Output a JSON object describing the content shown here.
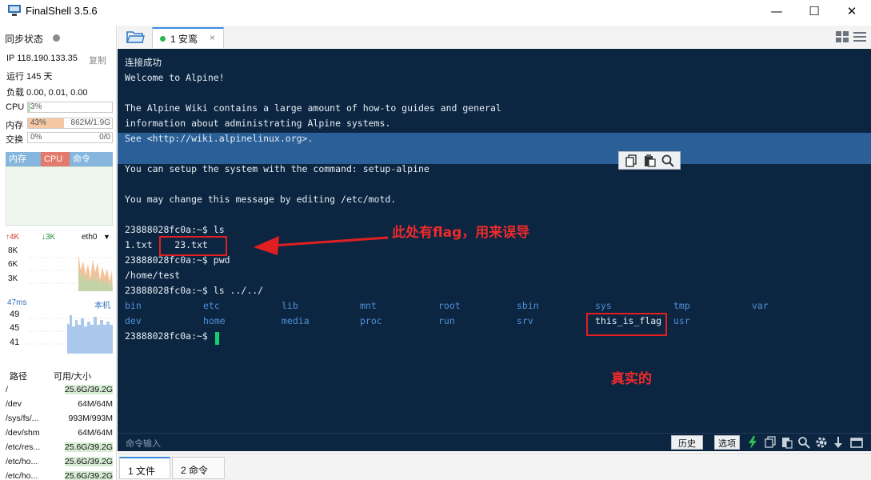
{
  "window": {
    "title": "FinalShell 3.5.6",
    "minimize": "—",
    "maximize": "☐",
    "close": "✕"
  },
  "sidebar": {
    "sync_label": "同步状态",
    "ip_label": "IP 118.190.133.35",
    "copy_label": "复制",
    "uptime": "运行 145 天",
    "load": "负载 0.00, 0.01, 0.00",
    "cpu": {
      "label": "CPU",
      "percent": "3%",
      "fraction": 0.03
    },
    "mem": {
      "label": "内存",
      "percent": "43%",
      "value": "862M/1.9G",
      "fraction": 0.43
    },
    "swap": {
      "label": "交换",
      "percent": "0%",
      "value": "0/0",
      "fraction": 0.0
    },
    "proc_tabs": [
      "内存",
      "CPU",
      "命令"
    ],
    "net": {
      "up": "↑4K",
      "down": "↓3K",
      "iface": "eth0",
      "axis": [
        "8K",
        "6K",
        "3K"
      ]
    },
    "ping": {
      "label": "47ms",
      "host": "本机",
      "axis": [
        "49",
        "45",
        "41"
      ]
    },
    "disk": {
      "headers": [
        "路径",
        "可用/大小"
      ],
      "rows": [
        {
          "path": "/",
          "size": "25.6G/39.2G"
        },
        {
          "path": "/dev",
          "size": "64M/64M"
        },
        {
          "path": "/sys/fs/...",
          "size": "993M/993M"
        },
        {
          "path": "/dev/shm",
          "size": "64M/64M"
        },
        {
          "path": "/etc/res...",
          "size": "25.6G/39.2G"
        },
        {
          "path": "/etc/ho...",
          "size": "25.6G/39.2G"
        },
        {
          "path": "/etc/ho...",
          "size": "25.6G/39.2G"
        }
      ]
    }
  },
  "tabs": {
    "session": {
      "label": "1 安鸾",
      "close": "×"
    }
  },
  "terminal": {
    "lines": [
      "连接成功",
      "Welcome to Alpine!",
      "",
      "The Alpine Wiki contains a large amount of how-to guides and general",
      "information about administrating Alpine systems.",
      "See <http://wiki.alpinelinux.org>.",
      "",
      "You can setup the system with the command: setup-alpine",
      "",
      "You may change this message by editing /etc/motd.",
      "",
      "23888028fc0a:~$ ls",
      "1.txt    23.txt",
      "23888028fc0a:~$ pwd",
      "/home/test",
      "23888028fc0a:~$ ls ../../"
    ],
    "dirs_row1": [
      "bin",
      "etc",
      "lib",
      "mnt",
      "root",
      "sbin",
      "sys",
      "tmp",
      "var"
    ],
    "dirs_row2": [
      "dev",
      "home",
      "media",
      "proc",
      "run",
      "srv",
      "this_is_flag",
      "usr"
    ],
    "prompt_last": "23888028fc0a:~$ "
  },
  "annotations": {
    "misleading": "此处有flag，用来误导",
    "real": "真实的"
  },
  "command_bar": {
    "input_label": "命令输入",
    "history": "历史",
    "options": "选项"
  },
  "bottom_tabs": [
    "1 文件",
    "2 命令"
  ],
  "colors": {
    "terminal_bg": "#0c2642",
    "dir_blue": "#4f8fd6",
    "annotation_red": "#e02020",
    "cursor_green": "#16d06b"
  }
}
